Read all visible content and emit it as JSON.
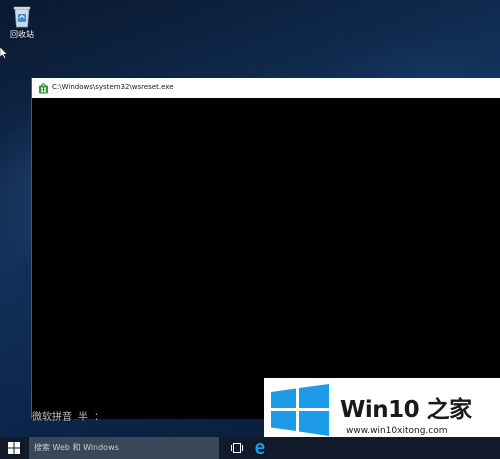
{
  "desktop": {
    "recycle_bin_label": "回收站"
  },
  "console": {
    "title": "C:\\Windows\\system32\\wsreset.exe",
    "ime_status": "微软拼音 半 ："
  },
  "watermark": {
    "title_part1": "Win10",
    "title_part2": " 之家",
    "url": "www.win10xitong.com"
  },
  "taskbar": {
    "search_placeholder": "搜索 Web 和 Windows"
  },
  "colors": {
    "windows_blue": "#1e9be8",
    "taskbar": "#101a2a",
    "search_box": "#3b4658"
  },
  "icons": {
    "recycle_bin": "recycle-bin-icon",
    "console": "store-icon",
    "start": "windows-logo-icon",
    "task_view": "task-view-icon",
    "edge": "edge-icon"
  }
}
